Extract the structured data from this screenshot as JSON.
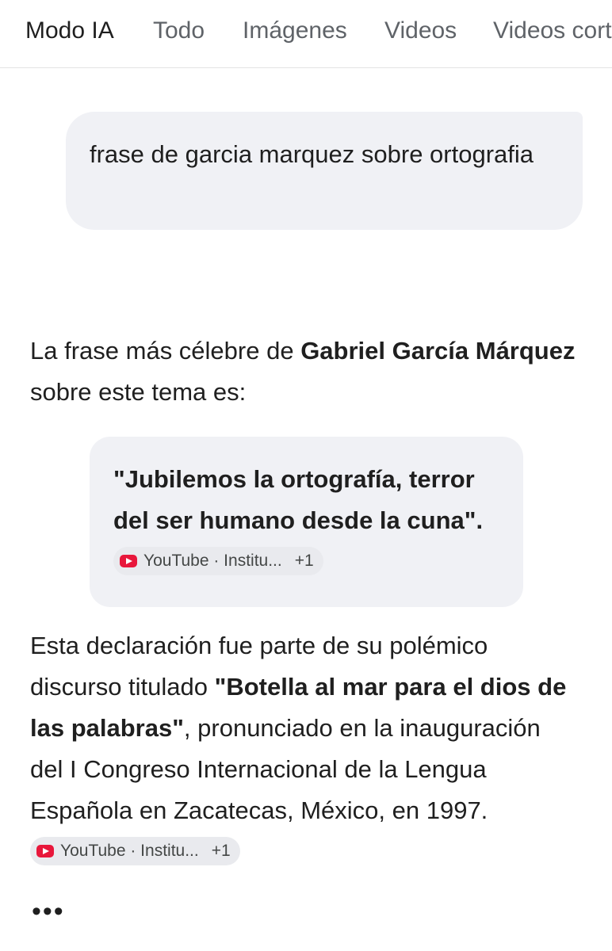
{
  "tabs": [
    {
      "label": "Modo IA",
      "active": true
    },
    {
      "label": "Todo",
      "active": false
    },
    {
      "label": "Imágenes",
      "active": false
    },
    {
      "label": "Videos",
      "active": false
    },
    {
      "label": "Videos cort",
      "active": false
    }
  ],
  "query": {
    "text": "frase de garcia marquez sobre ortografia"
  },
  "answer": {
    "intro_1": "La frase más célebre de ",
    "intro_bold": "Gabriel García Márquez",
    "intro_2": " sobre este tema es:",
    "quote": "\"Jubilemos la ortografía, terror del ser humano desde la cuna\".",
    "source_chip_1": {
      "icon": "youtube-icon",
      "label": "YouTube · Institu...",
      "extra": "+1"
    },
    "body_1": "Esta declaración fue parte de su polémico discurso titulado ",
    "body_bold": "\"Botella al mar para el dios de las palabras\"",
    "body_2": ", pronunciado en la inauguración del I Congreso Internacional de la Lengua Española en Zacatecas, México, en 1997.",
    "source_chip_2": {
      "icon": "youtube-icon",
      "label": "YouTube · Institu...",
      "extra": "+1"
    },
    "more": "•••"
  },
  "colors": {
    "bubble_bg": "#f0f1f5",
    "chip_bg": "#e9eaee",
    "youtube_red": "#e8173b",
    "tab_inactive": "#5f6368"
  }
}
